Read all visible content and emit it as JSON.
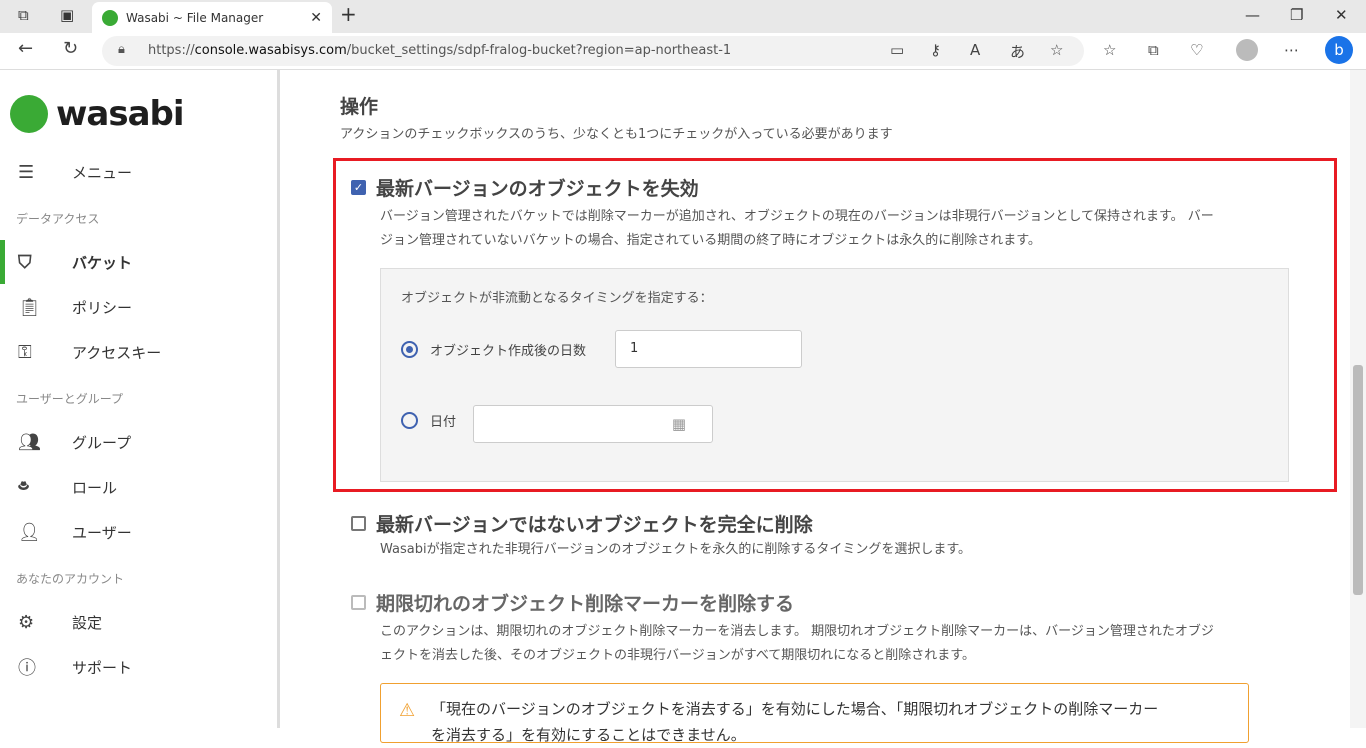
{
  "browser": {
    "tab_title": "Wasabi ~ File Manager",
    "url_prefix": "https://",
    "url_host": "console.wasabisys.com",
    "url_path": "/bucket_settings/sdpf-fralog-bucket?region=ap-northeast-1"
  },
  "sidebar": {
    "logo": "wasabi",
    "menu": "メニュー",
    "sections": [
      "データアクセス",
      "ユーザーとグループ",
      "あなたのアカウント"
    ],
    "items": [
      {
        "label": "バケット"
      },
      {
        "label": "ポリシー"
      },
      {
        "label": "アクセスキー"
      },
      {
        "label": "グループ"
      },
      {
        "label": "ロール"
      },
      {
        "label": "ユーザー"
      },
      {
        "label": "設定"
      },
      {
        "label": "サポート"
      }
    ]
  },
  "main": {
    "title": "操作",
    "subtitle": "アクションのチェックボックスのうち、少なくとも1つにチェックが入っている必要があります",
    "action1": {
      "label": "最新バージョンのオブジェクトを失効",
      "checked": true,
      "desc1": "バージョン管理されたバケットでは削除マーカーが追加され、オブジェクトの現在のバージョンは非現行バージョンとして保持されます。 バー",
      "desc2": "ジョン管理されていないバケットの場合、指定されている期間の終了時にオブジェクトは永久的に削除されます。",
      "timing_label": "オブジェクトが非流動となるタイミングを指定する：",
      "radio_days": "オブジェクト作成後の日数",
      "days_value": "1",
      "radio_date": "日付",
      "date_value": ""
    },
    "action2": {
      "label": "最新バージョンではないオブジェクトを完全に削除",
      "checked": false,
      "desc": "Wasabiが指定された非現行バージョンのオブジェクトを永久的に削除するタイミングを選択します。"
    },
    "action3": {
      "label": "期限切れのオブジェクト削除マーカーを削除する",
      "checked": false,
      "desc1": "このアクションは、期限切れのオブジェクト削除マーカーを消去します。 期限切れオブジェクト削除マーカーは、バージョン管理されたオブジ",
      "desc2": "ェクトを消去した後、そのオブジェクトの非現行バージョンがすべて期限切れになると削除されます。"
    },
    "warning1": "「現在のバージョンのオブジェクトを消去する」を有効にした場合、「期限切れオブジェクトの削除マーカー",
    "warning2": "を消去する」を有効にすることはできません。"
  }
}
